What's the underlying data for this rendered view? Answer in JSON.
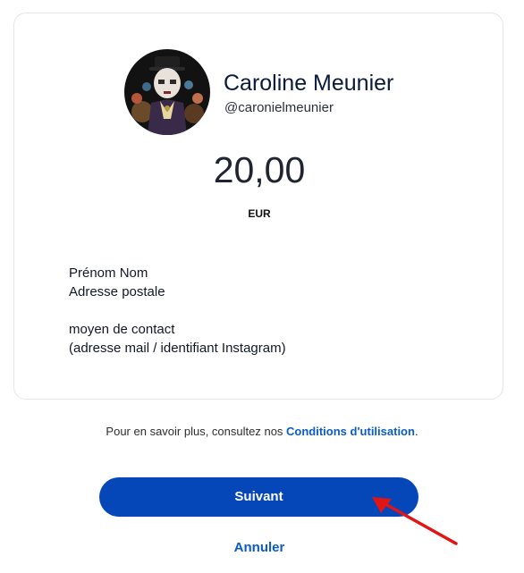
{
  "profile": {
    "name": "Caroline Meunier",
    "handle": "@caronielmeunier"
  },
  "payment": {
    "amount": "20,00",
    "currency": "EUR"
  },
  "note": {
    "line1": "Prénom Nom",
    "line2": "Adresse postale",
    "line3": "moyen de contact",
    "line4": "(adresse mail / identifiant Instagram)"
  },
  "terms": {
    "prefix": "Pour en savoir plus, consultez nos ",
    "link": "Conditions d'utilisation",
    "suffix": "."
  },
  "actions": {
    "next_label": "Suivant",
    "cancel_label": "Annuler"
  },
  "colors": {
    "primary_button": "#0546b8",
    "link": "#0a5cc7",
    "annotation_arrow": "#e01515"
  },
  "icons": {
    "avatar": "profile-photo",
    "annotation": "red-arrow-icon"
  }
}
